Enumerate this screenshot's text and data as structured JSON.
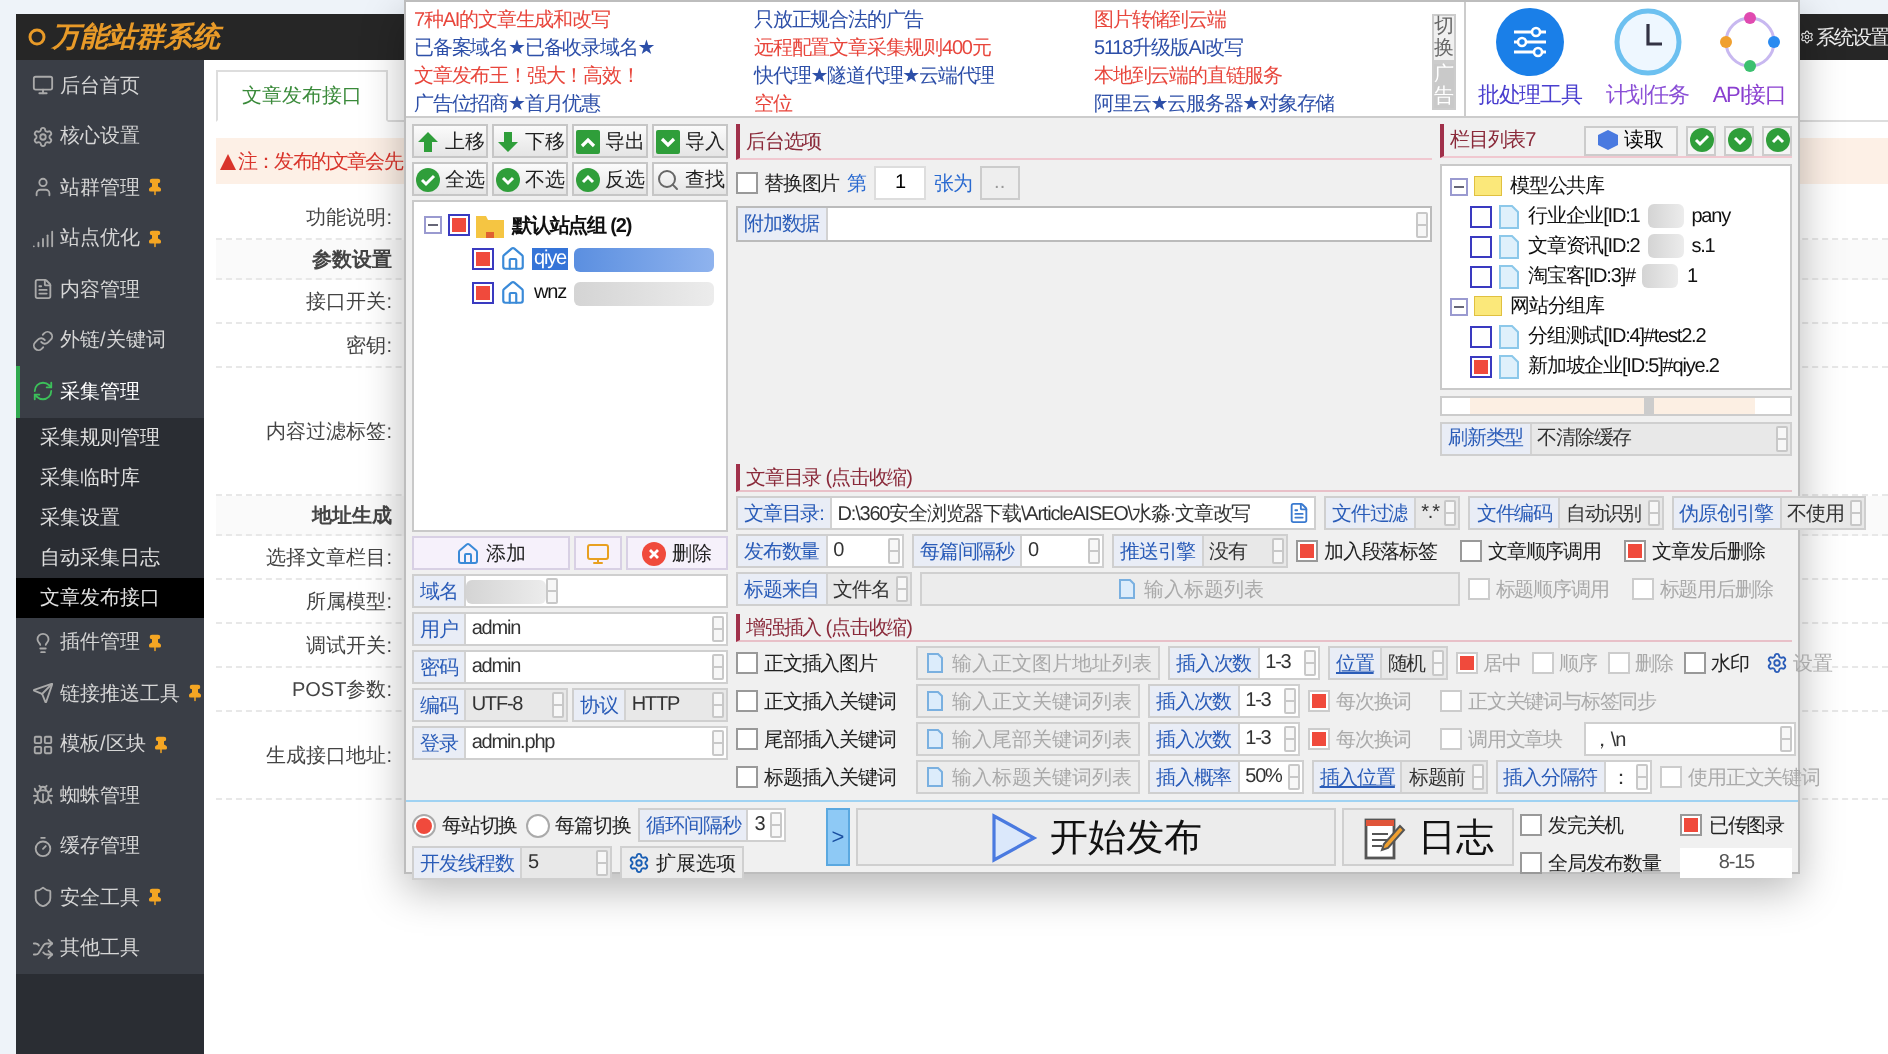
{
  "page": {
    "logo": "万能站群系统",
    "settings": "系统设置",
    "sidebar": [
      {
        "label": "后台首页",
        "starred": false,
        "selected": false
      },
      {
        "label": "核心设置",
        "starred": false,
        "selected": false
      },
      {
        "label": "站群管理",
        "starred": true,
        "selected": false
      },
      {
        "label": "站点优化",
        "starred": true,
        "selected": false
      },
      {
        "label": "内容管理",
        "starred": false,
        "selected": false
      },
      {
        "label": "外链/关键词",
        "starred": false,
        "selected": false
      },
      {
        "label": "采集管理",
        "starred": false,
        "selected": true,
        "children": [
          {
            "label": "采集规则管理",
            "selected": false
          },
          {
            "label": "采集临时库",
            "selected": false
          },
          {
            "label": "采集设置",
            "selected": false
          },
          {
            "label": "自动采集日志",
            "selected": false
          },
          {
            "label": "文章发布接口",
            "selected": true
          }
        ]
      },
      {
        "label": "插件管理",
        "starred": true,
        "selected": false
      },
      {
        "label": "链接推送工具",
        "starred": true,
        "selected": false
      },
      {
        "label": "模板/区块",
        "starred": true,
        "selected": false
      },
      {
        "label": "蜘蛛管理",
        "starred": false,
        "selected": false
      },
      {
        "label": "缓存管理",
        "starred": false,
        "selected": false
      },
      {
        "label": "安全工具",
        "starred": true,
        "selected": false
      },
      {
        "label": "其他工具",
        "starred": false,
        "selected": false
      }
    ],
    "tab": "文章发布接口",
    "notice": "注：发布的文章会先",
    "form": [
      {
        "kind": "field",
        "label": "功能说明:"
      },
      {
        "kind": "section",
        "label": "参数设置"
      },
      {
        "kind": "field",
        "label": "接口开关:"
      },
      {
        "kind": "field",
        "label": "密钥:"
      },
      {
        "kind": "area",
        "label": "内容过滤标签:"
      },
      {
        "kind": "section",
        "label": "地址生成"
      },
      {
        "kind": "field",
        "label": "选择文章栏目:"
      },
      {
        "kind": "field",
        "label": "所属模型:"
      },
      {
        "kind": "field",
        "label": "调试开关:"
      },
      {
        "kind": "field",
        "label": "POST参数:"
      },
      {
        "kind": "tall",
        "label": "生成接口地址:"
      }
    ]
  },
  "app": {
    "ad_columns": [
      [
        {
          "text": "7种AI的文章生成和改写",
          "color": "#e8463c"
        },
        {
          "text": "已备案域名★已备收录域名★",
          "color": "#2d4fa8"
        },
        {
          "text": "文章发布王！强大！高效！",
          "color": "#e8463c"
        },
        {
          "text": "广告位招商★首月优惠",
          "color": "#2d4fa8"
        }
      ],
      [
        {
          "text": "只放正规合法的广告",
          "color": "#2d4fa8"
        },
        {
          "text": "远程配置文章采集规则400元",
          "color": "#e8463c"
        },
        {
          "text": "快代理★隧道代理★云端代理",
          "color": "#2d4fa8"
        },
        {
          "text": "空位",
          "color": "#e8463c"
        }
      ],
      [
        {
          "text": "图片转储到云端",
          "color": "#e8463c"
        },
        {
          "text": "5118升级版AI改写",
          "color": "#2d4fa8"
        },
        {
          "text": "本地到云端的直链服务",
          "color": "#e8463c"
        },
        {
          "text": "阿里云★云服务器★对象存储",
          "color": "#2d4fa8"
        }
      ]
    ],
    "ad_switch": "切换",
    "ad_tag": "广告",
    "tools": [
      {
        "label": "批处理工具"
      },
      {
        "label": "计划任务"
      },
      {
        "label": "API接口"
      }
    ],
    "site_toolbar": [
      {
        "label": "上移"
      },
      {
        "label": "下移"
      },
      {
        "label": "导出"
      },
      {
        "label": "导入"
      },
      {
        "label": "全选"
      },
      {
        "label": "不选"
      },
      {
        "label": "反选"
      },
      {
        "label": "查找"
      }
    ],
    "site_tree": [
      {
        "label": "默认站点组 (2)",
        "checked": true,
        "selected": false,
        "expanded": true,
        "children": [
          {
            "label": "qiye",
            "checked": true,
            "selected": true,
            "redacted": true
          },
          {
            "label": "wnz",
            "checked": true,
            "selected": false,
            "redacted": true
          }
        ]
      }
    ],
    "site_actions": {
      "add": "添加",
      "delete": "删除"
    },
    "site_fields": [
      [
        {
          "kind": "input",
          "label": "域名",
          "redacted": true
        }
      ],
      [
        {
          "kind": "input",
          "label": "用户",
          "value": "admin"
        }
      ],
      [
        {
          "kind": "input",
          "label": "密码",
          "value": "admin"
        }
      ],
      [
        {
          "kind": "select",
          "label": "编码",
          "value": "UTF-8"
        },
        {
          "kind": "select",
          "label": "协议",
          "value": "HTTP"
        }
      ],
      [
        {
          "kind": "input",
          "label": "登录",
          "value": "admin.php"
        }
      ]
    ],
    "backend": {
      "title": "后台选项",
      "replace_image": {
        "label": "替换图片",
        "checked": false
      },
      "nth_prefix": "第",
      "nth_value": "1",
      "nth_suffix": "张为",
      "browse": "..",
      "extra_label": "附加数据"
    },
    "columns_panel": {
      "title": "栏目列表7",
      "read": "读取",
      "tree": [
        {
          "label": "模型公共库",
          "expanded": true,
          "children": [
            {
              "label": "行业企业[ID:1",
              "tail": "pany",
              "redacted": true,
              "checked": false
            },
            {
              "label": "文章资讯[ID:2",
              "tail": "s.1",
              "redacted": true,
              "checked": false
            },
            {
              "label": "淘宝客[ID:3]#",
              "tail": "1",
              "redacted": true,
              "checked": false
            }
          ]
        },
        {
          "label": "网站分组库",
          "expanded": true,
          "children": [
            {
              "label": "分组测试[ID:4]#test2.2",
              "redacted": false,
              "checked": false
            },
            {
              "label": "新加坡企业[ID:5]#qiye.2",
              "redacted": false,
              "checked": true
            }
          ]
        }
      ],
      "refresh": {
        "kind": "select",
        "label": "刷新类型",
        "value": "不清除缓存"
      }
    },
    "article_dir": {
      "title": "文章目录 (点击收缩)",
      "rows": [
        {
          "items": [
            {
              "kind": "path",
              "label": "文章目录:",
              "value": "D:\\360安全浏览器下载\\ArticleAISEO\\水淼·文章改写"
            },
            {
              "kind": "select",
              "label": "文件过滤",
              "value": "*.*"
            },
            {
              "kind": "select",
              "label": "文件编码",
              "value": "自动识别"
            },
            {
              "kind": "select",
              "label": "伪原创引擎",
              "value": "不使用"
            }
          ]
        },
        {
          "items": [
            {
              "kind": "input",
              "label": "发布数量",
              "value": "0"
            },
            {
              "kind": "input",
              "label": "每篇间隔秒",
              "value": "0"
            },
            {
              "kind": "select",
              "label": "推送引擎",
              "value": "没有"
            },
            {
              "kind": "check",
              "label": "加入段落标签",
              "checked": true,
              "disabled": false
            },
            {
              "kind": "check",
              "label": "文章顺序调用",
              "checked": false,
              "disabled": false
            },
            {
              "kind": "check",
              "label": "文章发后删除",
              "checked": true,
              "disabled": false
            }
          ]
        },
        {
          "items": [
            {
              "kind": "select",
              "label": "标题来自",
              "value": "文件名"
            },
            {
              "kind": "listbutton",
              "label": "输入标题列表",
              "disabled": true
            },
            {
              "kind": "check",
              "label": "标题顺序调用",
              "checked": false,
              "disabled": true
            },
            {
              "kind": "check",
              "label": "标题用后删除",
              "checked": false,
              "disabled": true
            }
          ]
        }
      ]
    },
    "enhance": {
      "title": "增强插入 (点击收缩)",
      "rows": [
        {
          "items": [
            {
              "kind": "check",
              "label": "正文插入图片",
              "checked": false,
              "disabled": false
            },
            {
              "kind": "listbutton",
              "label": "输入正文图片地址列表",
              "disabled": true
            },
            {
              "kind": "input",
              "label": "插入次数",
              "value": "1-3"
            },
            {
              "kind": "select",
              "label": "位置",
              "value": "随机"
            },
            {
              "kind": "check",
              "label": "居中",
              "checked": true,
              "disabled": true
            },
            {
              "kind": "check",
              "label": "顺序",
              "checked": false,
              "disabled": true
            },
            {
              "kind": "check",
              "label": "删除",
              "checked": false,
              "disabled": true
            },
            {
              "kind": "check",
              "label": "水印",
              "checked": false,
              "disabled": false
            },
            {
              "kind": "gearbutton",
              "label": "设置",
              "disabled": true
            }
          ]
        },
        {
          "items": [
            {
              "kind": "check",
              "label": "正文插入关键词",
              "checked": false,
              "disabled": false
            },
            {
              "kind": "listbutton",
              "label": "输入正文关键词列表",
              "disabled": true
            },
            {
              "kind": "input",
              "label": "插入次数",
              "value": "1-3"
            },
            {
              "kind": "check",
              "label": "每次换词",
              "checked": true,
              "disabled": true
            },
            {
              "kind": "check",
              "label": "正文关键词与标签同步",
              "checked": false,
              "disabled": true
            }
          ]
        },
        {
          "items": [
            {
              "kind": "check",
              "label": "尾部插入关键词",
              "checked": false,
              "disabled": false
            },
            {
              "kind": "listbutton",
              "label": "输入尾部关键词列表",
              "disabled": true
            },
            {
              "kind": "input",
              "label": "插入次数",
              "value": "1-3"
            },
            {
              "kind": "check",
              "label": "每次换词",
              "checked": true,
              "disabled": true
            },
            {
              "kind": "check",
              "label": "调用文章块",
              "checked": false,
              "disabled": true
            },
            {
              "kind": "input",
              "value": "，\\n"
            }
          ]
        },
        {
          "items": [
            {
              "kind": "check",
              "label": "标题插入关键词",
              "checked": false,
              "disabled": false
            },
            {
              "kind": "listbutton",
              "label": "输入标题关键词列表",
              "disabled": true
            },
            {
              "kind": "input",
              "label": "插入概率",
              "value": "50%"
            },
            {
              "kind": "select",
              "label": "插入位置",
              "value": "标题前"
            },
            {
              "kind": "input",
              "label": "插入分隔符",
              "value": "："
            },
            {
              "kind": "check",
              "label": "使用正文关键词",
              "checked": false,
              "disabled": true
            }
          ]
        }
      ]
    },
    "bottom": {
      "modes": [
        {
          "label": "每站切换",
          "selected": true
        },
        {
          "label": "每篇切换",
          "selected": false
        }
      ],
      "interval": {
        "label": "循环间隔秒",
        "value": "3"
      },
      "threads": {
        "kind": "select",
        "label": "开发线程数",
        "value": "5"
      },
      "extend": "扩展选项",
      "toggle": ">",
      "start": "开始发布",
      "log": "日志",
      "checks": [
        {
          "label": "发完关机",
          "checked": false
        },
        {
          "label": "已传图录",
          "checked": true
        },
        {
          "label": "全局发布数量",
          "checked": false
        }
      ],
      "global_count": "8-15"
    }
  }
}
